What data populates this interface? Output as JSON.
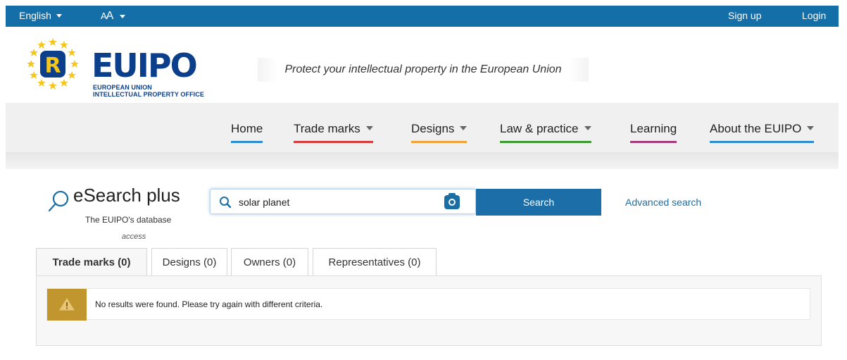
{
  "topbar": {
    "language": "English",
    "font_size_label": "A",
    "font_size_small": "A",
    "signup": "Sign up",
    "login": "Login"
  },
  "logo": {
    "name_eu": "EU",
    "name_ipo": "IPO",
    "subtitle_line1": "EUROPEAN UNION",
    "subtitle_line2": "INTELLECTUAL PROPERTY OFFICE",
    "letter": "R"
  },
  "tagline": "Protect your intellectual property in the European Union",
  "nav": {
    "items": [
      {
        "label": "Home",
        "color": "#2b8ad0"
      },
      {
        "label": "Trade marks",
        "color": "#d63a3a"
      },
      {
        "label": "Designs",
        "color": "#f0a23a"
      },
      {
        "label": "Law & practice",
        "color": "#3a9a2e"
      },
      {
        "label": "Learning",
        "color": "#a33a7a"
      },
      {
        "label": "About the EUIPO",
        "color": "#2b8ad0"
      }
    ]
  },
  "esearch": {
    "title": "eSearch plus",
    "subtitle": "The EUIPO's database",
    "subtitle2": "access"
  },
  "search": {
    "value": "solar planet",
    "button": "Search",
    "advanced": "Advanced search"
  },
  "tabs": [
    {
      "label": "Trade marks (0)",
      "active": true
    },
    {
      "label": "Designs (0)",
      "active": false
    },
    {
      "label": "Owners (0)",
      "active": false
    },
    {
      "label": "Representatives (0)",
      "active": false
    }
  ],
  "alert": {
    "message": "No results were found. Please try again with different criteria."
  },
  "colors": {
    "topbar": "#146ea8",
    "brand": "#0b3f8c",
    "button": "#1b6ea8",
    "warning": "#c1962f"
  }
}
